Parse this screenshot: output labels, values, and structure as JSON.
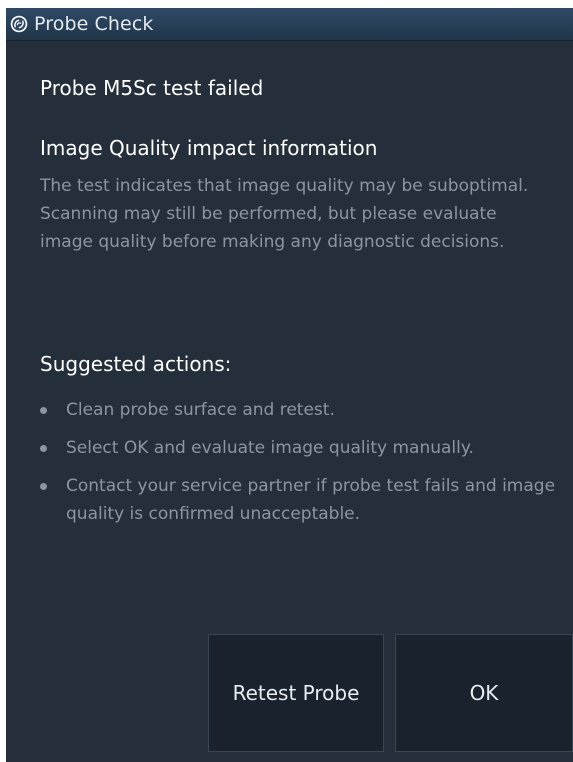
{
  "dialog": {
    "title": "Probe Check",
    "logo_icon": "ge-logo-icon"
  },
  "main": {
    "status": "Probe M5Sc test failed",
    "impact_heading": "Image Quality impact information",
    "impact_paragraphs": [
      "The test indicates that image quality may be suboptimal.",
      "Scanning may still be performed, but please evaluate image quality before making any diagnostic decisions."
    ],
    "actions_heading": "Suggested actions:",
    "actions": [
      "Clean probe surface and retest.",
      "Select OK and evaluate image quality manually.",
      "Contact your service partner if probe test fails and image quality is confirmed unacceptable."
    ]
  },
  "buttons": {
    "retest_label": "Retest Probe",
    "ok_label": "OK"
  },
  "colors": {
    "background": "#242f3b",
    "titlebar": "#2a4259",
    "body_text": "#8c96a1",
    "heading_text": "#ffffff",
    "button_bg": "#19222d"
  }
}
